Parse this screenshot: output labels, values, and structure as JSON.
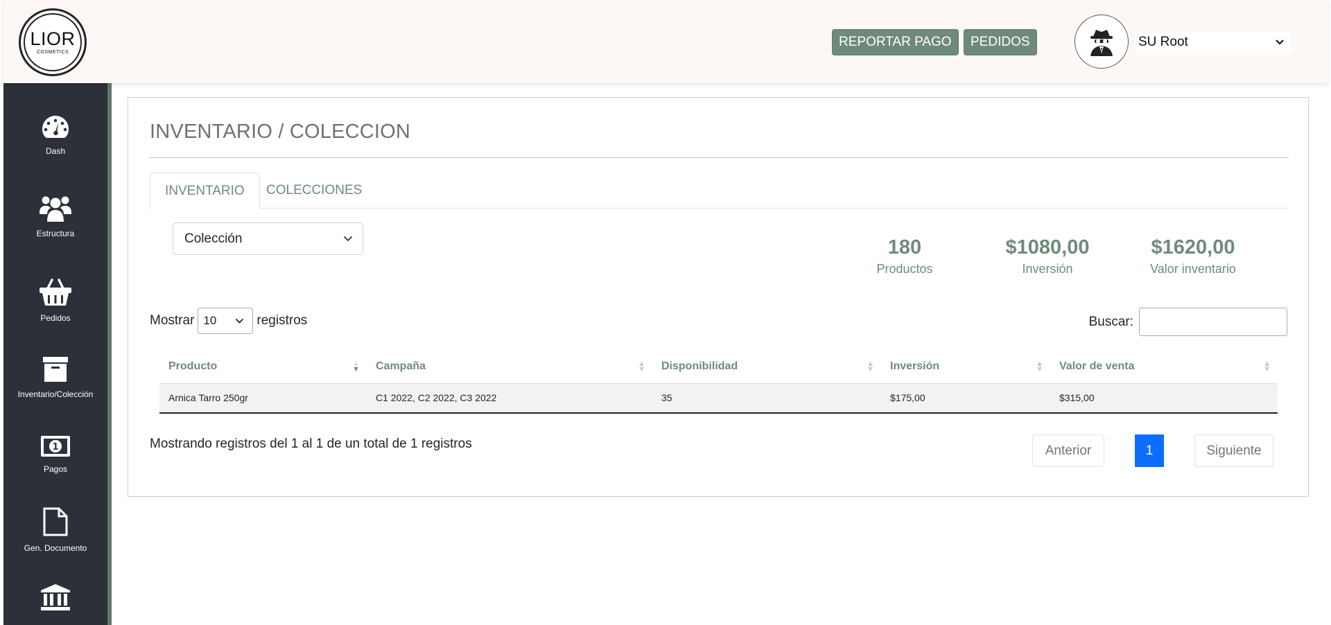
{
  "header": {
    "logo_text": "LIOR",
    "logo_subtext": "COSMETICS",
    "report_button": "REPORTAR PAGO",
    "orders_button": "PEDIDOS",
    "user_name": "SU Root"
  },
  "sidebar": {
    "items": [
      {
        "label": "Dash",
        "icon": "dashboard-gauge-icon"
      },
      {
        "label": "Estructura",
        "icon": "users-icon"
      },
      {
        "label": "Pedidos",
        "icon": "basket-icon"
      },
      {
        "label": "Inventario/Colección",
        "icon": "archive-box-icon"
      },
      {
        "label": "Pagos",
        "icon": "banknote-icon"
      },
      {
        "label": "Gen. Documento",
        "icon": "document-icon"
      },
      {
        "label": "",
        "icon": "bank-icon"
      }
    ]
  },
  "main": {
    "title": "INVENTARIO / COLECCION",
    "tabs": [
      "INVENTARIO",
      "COLECCIONES"
    ],
    "collection_select": "Colección",
    "stats": [
      {
        "value": "180",
        "caption": "Productos"
      },
      {
        "value": "$1080,00",
        "caption": "Inversión"
      },
      {
        "value": "$1620,00",
        "caption": "Valor inventario"
      }
    ],
    "show_label": "Mostrar",
    "page_length": "10",
    "records_label": "registros",
    "search_label": "Buscar:",
    "table": {
      "columns": [
        "Producto",
        "Campaña",
        "Disponibilidad",
        "Inversión",
        "Valor de venta"
      ],
      "rows": [
        [
          "Arnica Tarro 250gr",
          "C1 2022, C2 2022, C3 2022",
          "35",
          "$175,00",
          "$315,00"
        ]
      ]
    },
    "info": "Mostrando registros del 1 al 1 de un total de 1 registros",
    "pagination": {
      "prev": "Anterior",
      "current": "1",
      "next": "Siguiente"
    }
  },
  "colors": {
    "accent": "#6f8a7c",
    "sidebar_bg": "#2c3039",
    "header_bg": "#fdf8f6",
    "page_active": "#0d6efd"
  }
}
